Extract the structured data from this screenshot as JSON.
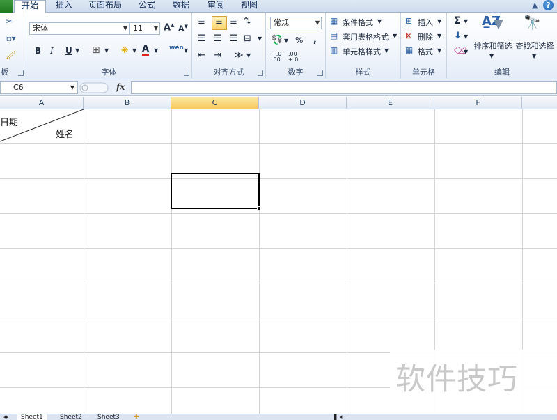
{
  "tabs": [
    {
      "label": "开始",
      "active": true
    },
    {
      "label": "插入",
      "active": false
    },
    {
      "label": "页面布局",
      "active": false
    },
    {
      "label": "公式",
      "active": false
    },
    {
      "label": "数据",
      "active": false
    },
    {
      "label": "审阅",
      "active": false
    },
    {
      "label": "视图",
      "active": false
    }
  ],
  "ribbon": {
    "clipboard": {
      "label": "板"
    },
    "font": {
      "label": "字体",
      "font_name": "宋体",
      "font_size": "11",
      "bold": "B",
      "italic": "I",
      "underline": "U",
      "grow": "A",
      "shrink": "A",
      "font_color_glyph": "A",
      "phonetic_glyph": "wén"
    },
    "alignment": {
      "label": "对齐方式"
    },
    "number": {
      "label": "数字",
      "format": "常规",
      "percent": "%",
      "comma": ",",
      "inc_decimal": "+.0 .00",
      "dec_decimal": ".00 +.0"
    },
    "styles": {
      "label": "样式",
      "conditional": "条件格式",
      "table_format": "套用表格格式",
      "cell_styles": "单元格样式"
    },
    "cells": {
      "label": "单元格",
      "insert": "插入",
      "delete": "删除",
      "format": "格式"
    },
    "editing": {
      "label": "编辑",
      "sum_glyph": "Σ",
      "sort_filter": "排序和筛选",
      "find_select": "查找和选择"
    }
  },
  "formula_bar": {
    "name_box": "C6",
    "fx": "fx",
    "value": ""
  },
  "sheet": {
    "columns": [
      "A",
      "B",
      "C",
      "D",
      "E",
      "F"
    ],
    "selected_column": "C",
    "active_cell": "C6",
    "cells": {
      "A1_top": "日期",
      "A1_bottom": "姓名"
    }
  },
  "sheet_tabs": [
    "Sheet1",
    "Sheet2",
    "Sheet3"
  ],
  "watermark": "软件技巧",
  "colors": {
    "accent_file": "#2a8a2a",
    "selected_header": "#f7c95b",
    "gridline": "#d4d4d4"
  }
}
